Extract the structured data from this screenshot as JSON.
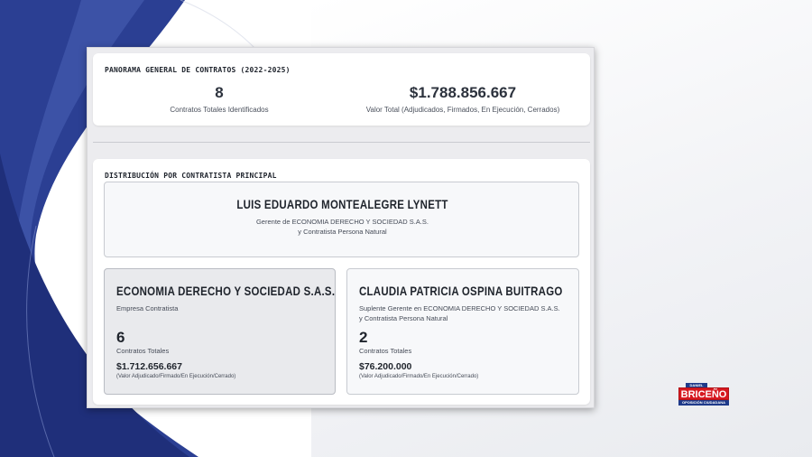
{
  "overview": {
    "title": "PANORAMA GENERAL DE CONTRATOS (2022-2025)",
    "total_contracts": "8",
    "total_contracts_label": "Contratos Totales Identificados",
    "total_value": "$1.788.856.667",
    "total_value_label": "Valor Total (Adjudicados, Firmados, En Ejecución, Cerrados)"
  },
  "distribution": {
    "title": "DISTRIBUCIÓN POR CONTRATISTA PRINCIPAL",
    "principal": {
      "name": "LUIS EDUARDO MONTEALEGRE LYNETT",
      "role_line1": "Gerente de ECONOMIA DERECHO Y SOCIEDAD S.A.S.",
      "role_line2": "y Contratista Persona Natural"
    },
    "contractors": [
      {
        "name": "ECONOMIA DERECHO Y SOCIEDAD S.A.S.",
        "desc_line1": "Empresa Contratista",
        "desc_line2": "",
        "count": "6",
        "count_label": "Contratos Totales",
        "value": "$1.712.656.667",
        "value_note": "(Valor Adjudicado/Firmado/En Ejecución/Cerrado)"
      },
      {
        "name": "CLAUDIA PATRICIA OSPINA BUITRAGO",
        "desc_line1": "Suplente Gerente en ECONOMIA DERECHO Y SOCIEDAD S.A.S.",
        "desc_line2": "y Contratista Persona Natural",
        "count": "2",
        "count_label": "Contratos Totales",
        "value": "$76.200.000",
        "value_note": "(Valor Adjudicado/Firmado/En Ejecución/Cerrado)"
      }
    ]
  },
  "logo": {
    "top": "DANIEL",
    "main": "BRICEÑO",
    "sub": "OPOSICIÓN CIUDADANA"
  }
}
